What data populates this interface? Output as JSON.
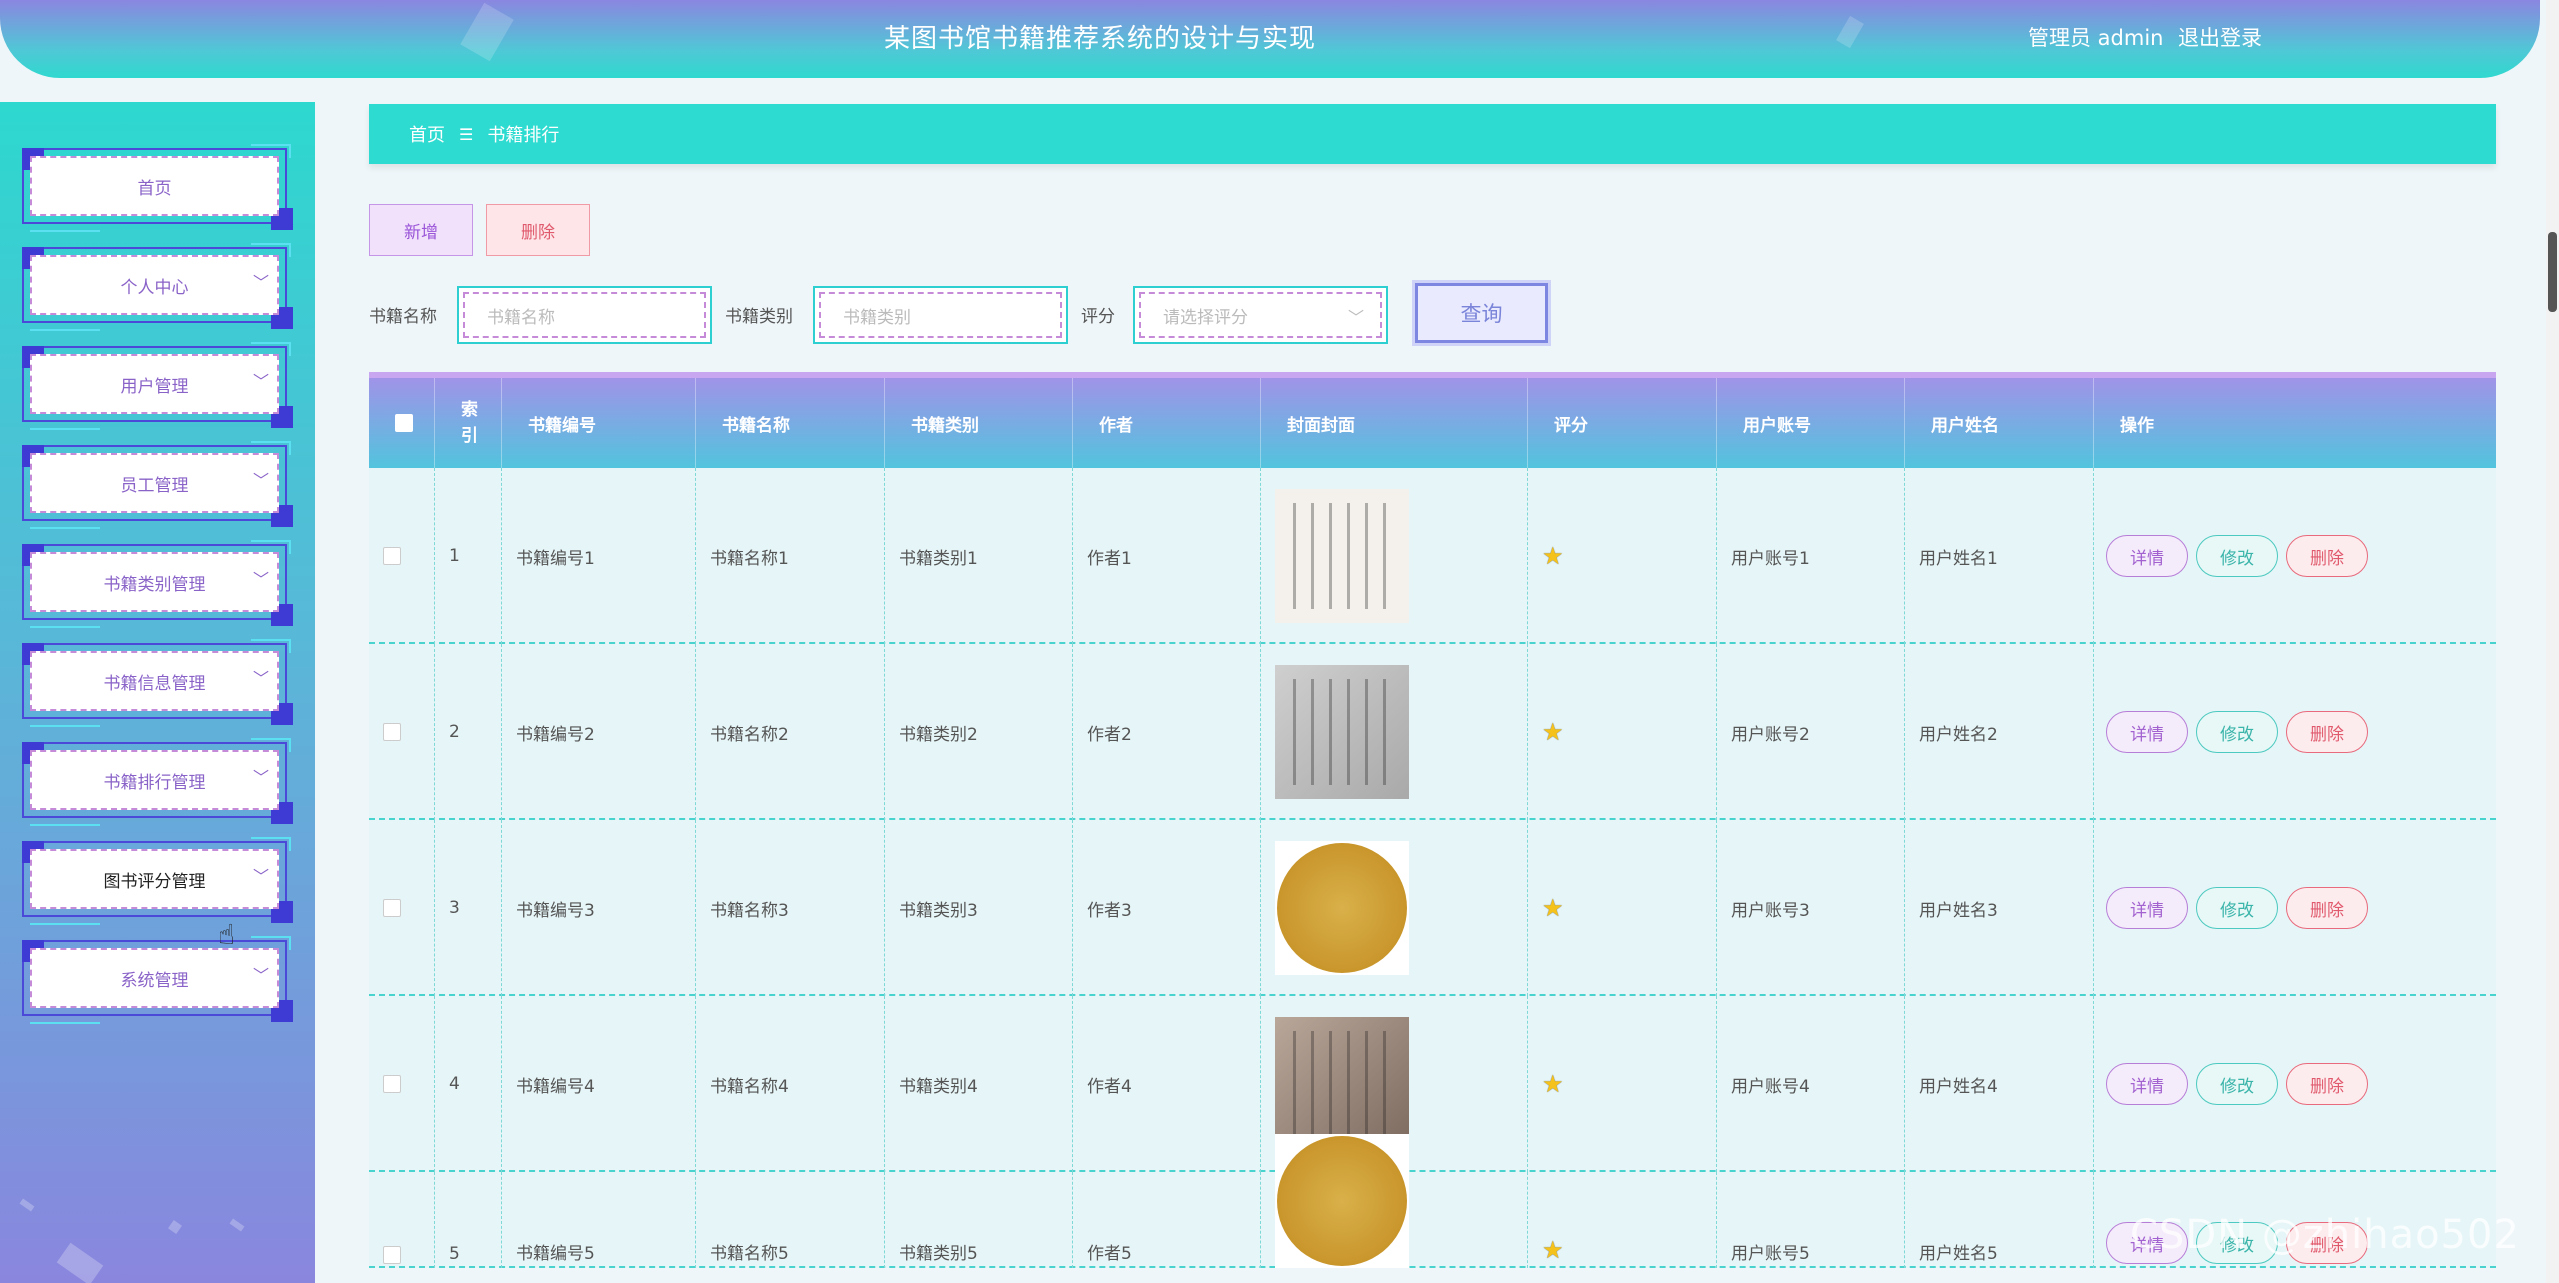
{
  "header": {
    "title": "某图书馆书籍推荐系统的设计与实现",
    "user": "管理员 admin",
    "logout": "退出登录"
  },
  "sidebar": {
    "items": [
      {
        "label": "首页",
        "has_arrow": false
      },
      {
        "label": "个人中心",
        "has_arrow": true
      },
      {
        "label": "用户管理",
        "has_arrow": true
      },
      {
        "label": "员工管理",
        "has_arrow": true
      },
      {
        "label": "书籍类别管理",
        "has_arrow": true
      },
      {
        "label": "书籍信息管理",
        "has_arrow": true
      },
      {
        "label": "书籍排行管理",
        "has_arrow": true
      },
      {
        "label": "图书评分管理",
        "has_arrow": true,
        "active": true
      },
      {
        "label": "系统管理",
        "has_arrow": true
      }
    ]
  },
  "breadcrumb": {
    "home": "首页",
    "sep": "☰",
    "current": "书籍排行"
  },
  "toolbar": {
    "add": "新增",
    "delete": "删除"
  },
  "search": {
    "name_label": "书籍名称",
    "name_placeholder": "书籍名称",
    "type_label": "书籍类别",
    "type_placeholder": "书籍类别",
    "rating_label": "评分",
    "rating_placeholder": "请选择评分",
    "query": "查询"
  },
  "table": {
    "headers": [
      "",
      "索引",
      "书籍编号",
      "书籍名称",
      "书籍类别",
      "作者",
      "封面封面",
      "评分",
      "用户账号",
      "用户姓名",
      "操作"
    ],
    "rows": [
      {
        "index": "1",
        "code": "书籍编号1",
        "name": "书籍名称1",
        "type": "书籍类别1",
        "author": "作者1",
        "rating_stars": 1,
        "account": "用户账号1",
        "username": "用户姓名1",
        "cover": "calligraphy-light"
      },
      {
        "index": "2",
        "code": "书籍编号2",
        "name": "书籍名称2",
        "type": "书籍类别2",
        "author": "作者2",
        "rating_stars": 1,
        "account": "用户账号2",
        "username": "用户姓名2",
        "cover": "calligraphy-grey"
      },
      {
        "index": "3",
        "code": "书籍编号3",
        "name": "书籍名称3",
        "type": "书籍类别3",
        "author": "作者3",
        "rating_stars": 1,
        "account": "用户账号3",
        "username": "用户姓名3",
        "cover": "calligraphy-round"
      },
      {
        "index": "4",
        "code": "书籍编号4",
        "name": "书籍名称4",
        "type": "书籍类别4",
        "author": "作者4",
        "rating_stars": 1,
        "account": "用户账号4",
        "username": "用户姓名4",
        "cover": "calligraphy-brown"
      },
      {
        "index": "5",
        "code": "书籍编号5",
        "name": "书籍名称5",
        "type": "书籍类别5",
        "author": "作者5",
        "rating_stars": 1,
        "account": "用户账号5",
        "username": "用户姓名5",
        "cover": "calligraphy-round"
      }
    ],
    "actions": {
      "detail": "详情",
      "edit": "修改",
      "delete": "删除"
    }
  },
  "watermark": "CSDN @zhihao502",
  "colors": {
    "accent": "#2ddbd0",
    "purple": "#8a63c8",
    "danger": "#e05a6d",
    "star": "#f4c21a"
  }
}
